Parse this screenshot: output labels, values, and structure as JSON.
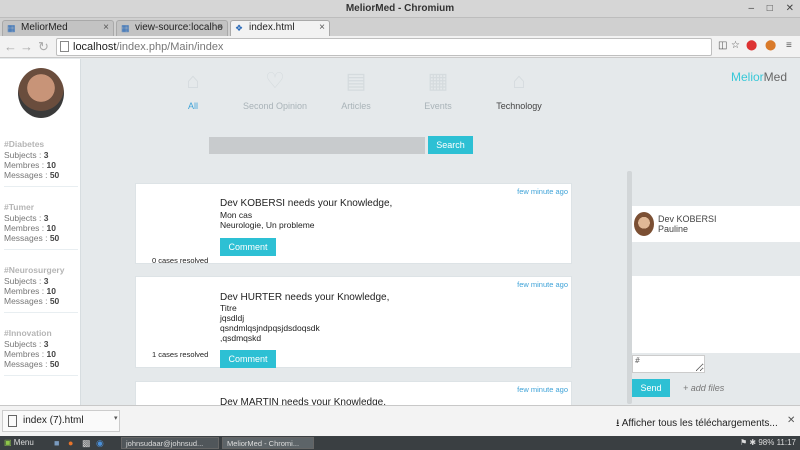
{
  "window": {
    "title": "MeliorMed - Chromium"
  },
  "tabs": [
    {
      "label": "MeliorMed",
      "active": false
    },
    {
      "label": "view-source:localho",
      "active": false
    },
    {
      "label": "index.html",
      "active": true
    }
  ],
  "address": {
    "host": "localhost",
    "path": "/index.php/Main/index"
  },
  "sidebar": {
    "groups": [
      {
        "title": "#Diabetes",
        "subjects_label": "Subjects : ",
        "subjects": "3",
        "members_label": "Membres : ",
        "members": "10",
        "messages_label": "Messages : ",
        "messages": "50"
      },
      {
        "title": "#Tumer",
        "subjects_label": "Subjects : ",
        "subjects": "3",
        "members_label": "Membres : ",
        "members": "10",
        "messages_label": "Messages : ",
        "messages": "50"
      },
      {
        "title": "#Neurosurgery",
        "subjects_label": "Subjects : ",
        "subjects": "3",
        "members_label": "Membres : ",
        "members": "10",
        "messages_label": "Messages : ",
        "messages": "50"
      },
      {
        "title": "#Innovation",
        "subjects_label": "Subjects : ",
        "subjects": "3",
        "members_label": "Membres : ",
        "members": "10",
        "messages_label": "Messages : ",
        "messages": "50"
      }
    ]
  },
  "topnav": [
    {
      "label": "All",
      "icon": "home-icon"
    },
    {
      "label": "Second Opinion",
      "icon": "heart-icon"
    },
    {
      "label": "Articles",
      "icon": "chat-icon"
    },
    {
      "label": "Events",
      "icon": "calendar-icon"
    },
    {
      "label": "Technology",
      "icon": "home-icon"
    }
  ],
  "brand": {
    "part1": "Melior",
    "part2": "Med"
  },
  "search": {
    "placeholder": "",
    "button": "Search"
  },
  "posts": [
    {
      "time": "few minute ago",
      "headline": "Dev KOBERSI needs your Knowledge,",
      "lines": [
        "Mon cas",
        "Neurologie, Un probleme"
      ],
      "resolved": "0 cases resolved",
      "comment": "Comment"
    },
    {
      "time": "few minute ago",
      "headline": "Dev HURTER needs your Knowledge,",
      "lines": [
        "Titre",
        "jqsdldj",
        "qsndmlqsjndpqsjdsdoqsdk",
        ",qsdmqskd"
      ],
      "resolved": "1 cases resolved",
      "comment": "Comment"
    },
    {
      "time": "few minute ago",
      "headline": "Dev MARTIN needs your Knowledge,"
    }
  ],
  "chat": {
    "contact_name": "Dev KOBERSI",
    "contact_sub": "Pauline",
    "message_placeholder": "#",
    "send": "Send",
    "add_files": "+ add files"
  },
  "downloads": {
    "file": "index (7).html",
    "show_all": "Afficher tous les téléchargements..."
  },
  "taskbar": {
    "menu": "Menu",
    "items": [
      "johnsudaar@johnsud...",
      "MeliorMed - Chromi..."
    ],
    "battery": "98%",
    "clock": "11:17"
  }
}
